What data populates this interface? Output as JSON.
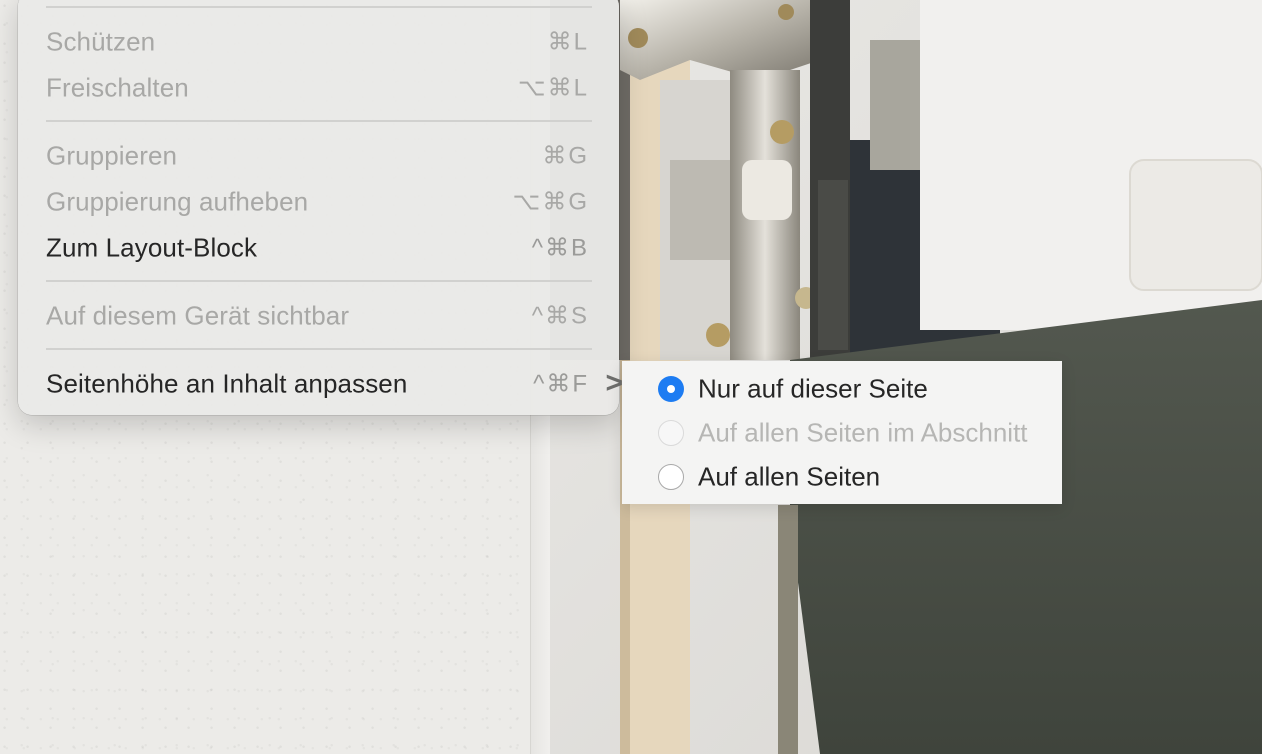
{
  "menu": {
    "items": [
      {
        "label": "Schützen",
        "shortcut": "⌘L",
        "enabled": false
      },
      {
        "label": "Freischalten",
        "shortcut": "⌥⌘L",
        "enabled": false
      },
      {
        "label": "Gruppieren",
        "shortcut": "⌘G",
        "enabled": false
      },
      {
        "label": "Gruppierung aufheben",
        "shortcut": "⌥⌘G",
        "enabled": false
      },
      {
        "label": "Zum Layout-Block",
        "shortcut": "^⌘B",
        "enabled": true
      },
      {
        "label": "Auf diesem Gerät sichtbar",
        "shortcut": "^⌘S",
        "enabled": false
      },
      {
        "label": "Seitenhöhe an Inhalt anpassen",
        "shortcut": "^⌘F",
        "enabled": true,
        "submenu_indicator": ">"
      }
    ]
  },
  "submenu": {
    "options": [
      {
        "label": "Nur auf dieser Seite",
        "selected": true,
        "enabled": true
      },
      {
        "label": "Auf allen Seiten im Abschnitt",
        "selected": false,
        "enabled": false
      },
      {
        "label": "Auf allen Seiten",
        "selected": false,
        "enabled": true
      }
    ]
  },
  "colors": {
    "accent": "#1d7cf2",
    "menu_background": "#e9e9e7",
    "disabled_text": "#a8a8a6",
    "enabled_text": "#262626"
  }
}
